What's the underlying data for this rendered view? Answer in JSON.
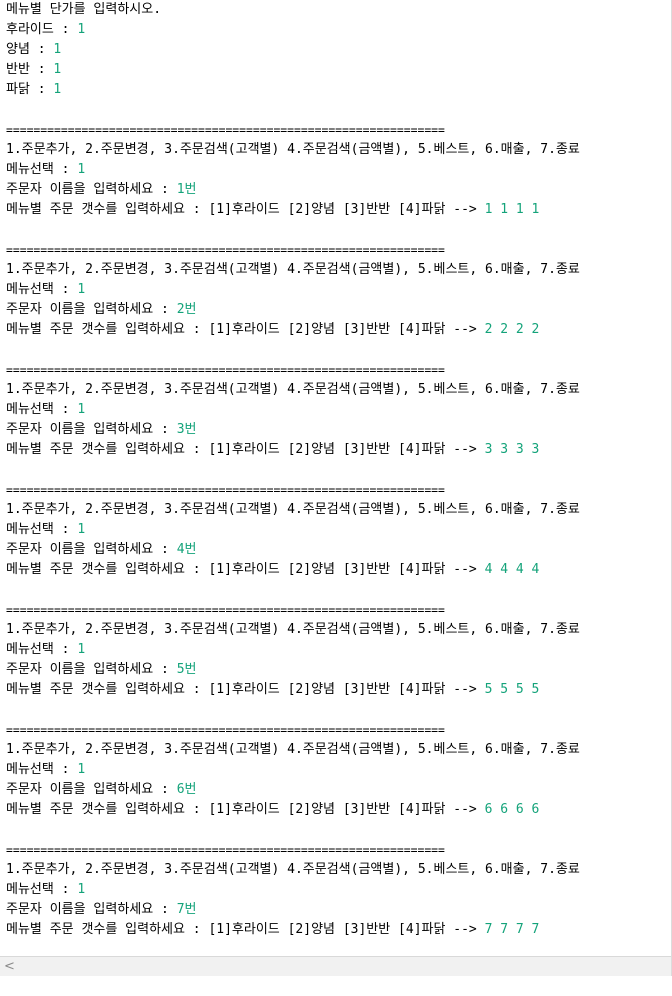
{
  "prices": {
    "prompt": "메뉴별 단가를 입력하시오.",
    "items": [
      {
        "label": "후라이드 : ",
        "value": "1"
      },
      {
        "label": "양념 : ",
        "value": "1"
      },
      {
        "label": "반반 : ",
        "value": "1"
      },
      {
        "label": "파닭 : ",
        "value": "1"
      }
    ]
  },
  "separator": "================================================================",
  "menu_line": "1.주문추가, 2.주문변경, 3.주문검색(고객별) 4.주문검색(금액별), 5.베스트, 6.매출, 7.종료",
  "select_prompt": "메뉴선택 : ",
  "name_prompt": "주문자 이름을 입력하세요 : ",
  "count_prompt": "메뉴별 주문 갯수를 입력하세요 : [1]후라이드 [2]양념 [3]반반 [4]파닭 --> ",
  "orders": [
    {
      "menu": "1",
      "name": "1번",
      "counts": "1 1 1 1"
    },
    {
      "menu": "1",
      "name": "2번",
      "counts": "2 2 2 2"
    },
    {
      "menu": "1",
      "name": "3번",
      "counts": "3 3 3 3"
    },
    {
      "menu": "1",
      "name": "4번",
      "counts": "4 4 4 4"
    },
    {
      "menu": "1",
      "name": "5번",
      "counts": "5 5 5 5"
    },
    {
      "menu": "1",
      "name": "6번",
      "counts": "6 6 6 6"
    },
    {
      "menu": "1",
      "name": "7번",
      "counts": "7 7 7 7"
    }
  ],
  "scrollbar": {
    "left_arrow": "<"
  }
}
